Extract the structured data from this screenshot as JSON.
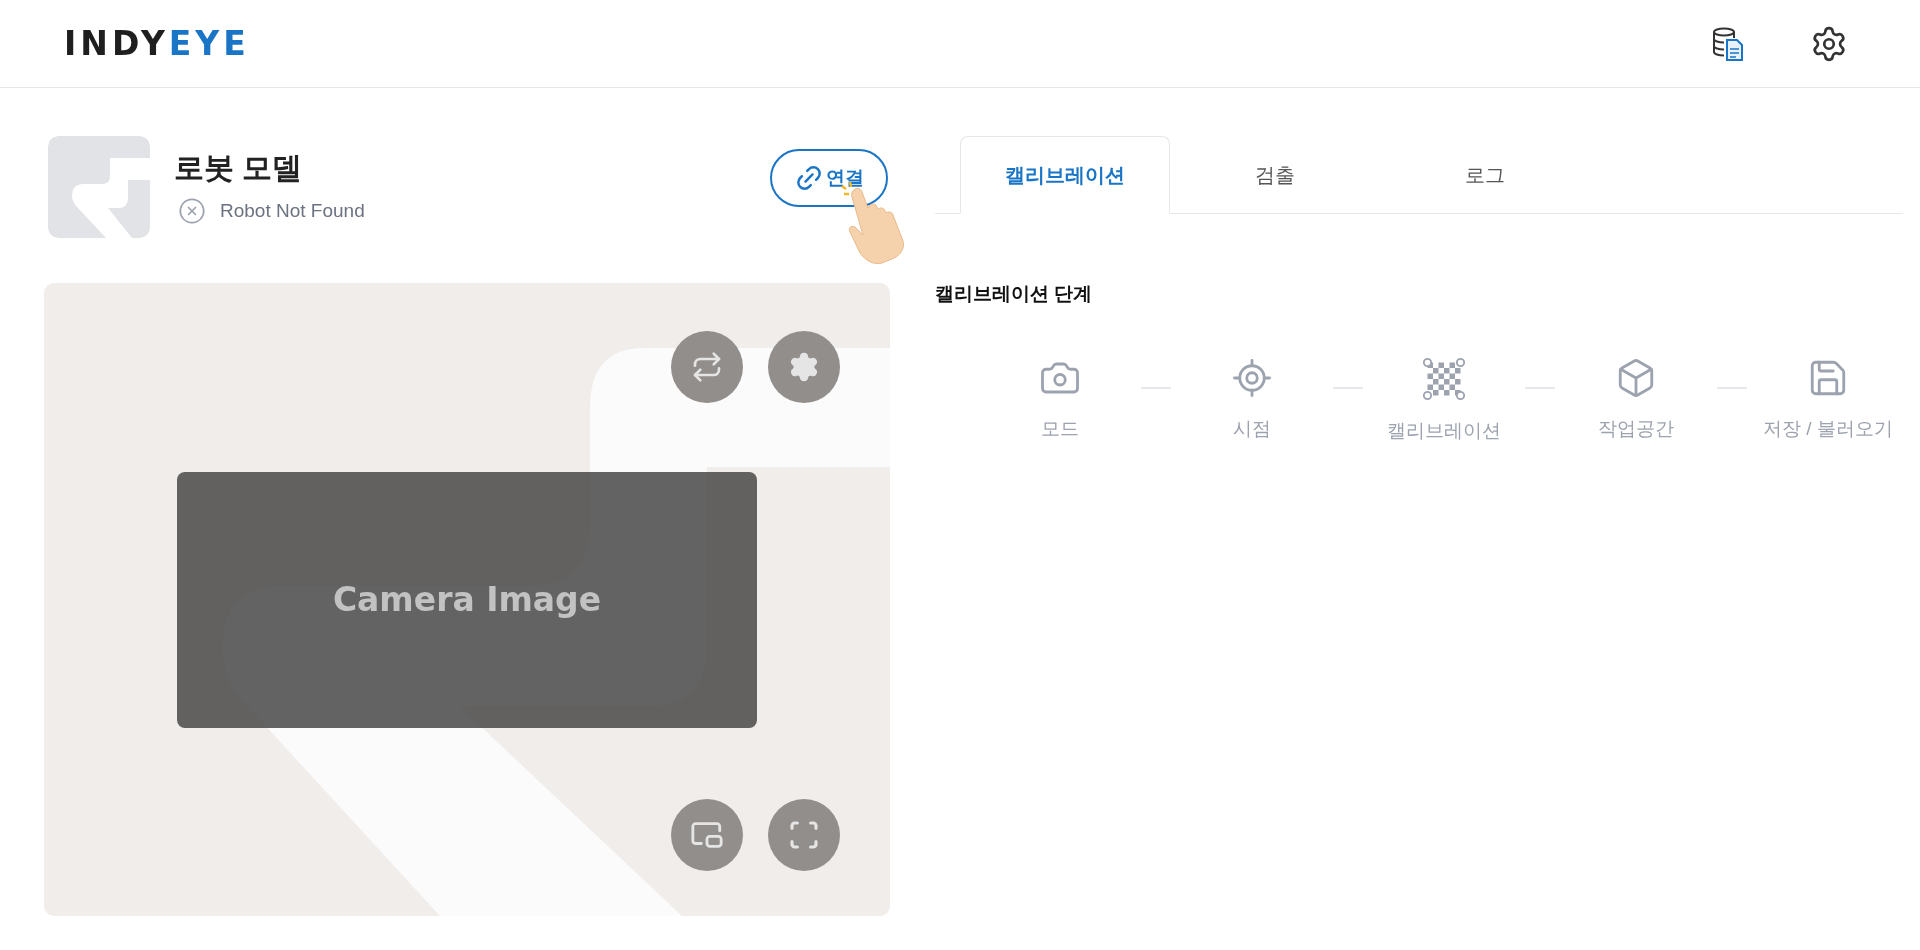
{
  "header": {
    "logo": {
      "dark_part": "INDY",
      "accent_part": "EYE"
    }
  },
  "robot": {
    "model": "로봇 모델",
    "status": "Robot Not Found",
    "connect_button": "연결"
  },
  "camera": {
    "overlay_text": "Camera Image"
  },
  "tabs": [
    {
      "label": "캘리브레이션",
      "selected": true
    },
    {
      "label": "검출",
      "selected": false
    },
    {
      "label": "로그",
      "selected": false
    }
  ],
  "calibration": {
    "title": "캘리브레이션 단계",
    "steps": [
      {
        "label": "모드"
      },
      {
        "label": "시점"
      },
      {
        "label": "캘리브레이션"
      },
      {
        "label": "작업공간"
      },
      {
        "label": "저장 / 불러오기"
      }
    ]
  }
}
